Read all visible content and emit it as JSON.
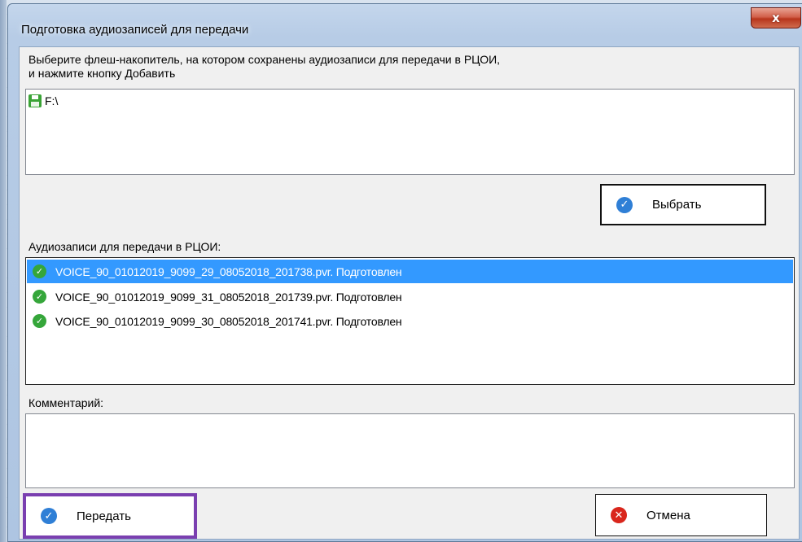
{
  "window": {
    "title": "Подготовка аудиозаписей для передачи",
    "close_symbol": "x"
  },
  "instructions": {
    "line1": "Выберите флеш-накопитель, на котором сохранены аудиозаписи для передачи в РЦОИ,",
    "line2": "и нажмите кнопку Добавить"
  },
  "drives": [
    {
      "label": "F:\\",
      "icon": "floppy-icon"
    }
  ],
  "select_button": {
    "label": "Выбрать",
    "icon": "check-circle-icon"
  },
  "recordings": {
    "label": "Аудиозаписи для передачи в РЦОИ:",
    "items": [
      {
        "name": "VOICE_90_01012019_9099_29_08052018_201738.pvr. Подготовлен",
        "selected": true
      },
      {
        "name": "VOICE_90_01012019_9099_31_08052018_201739.pvr. Подготовлен",
        "selected": false
      },
      {
        "name": "VOICE_90_01012019_9099_30_08052018_201741.pvr. Подготовлен",
        "selected": false
      }
    ],
    "status_icon": "green-check-icon"
  },
  "comment": {
    "label": "Комментарий:",
    "value": ""
  },
  "footer": {
    "send_label": "Передать",
    "cancel_label": "Отмена"
  },
  "colors": {
    "selection": "#3399ff",
    "send_highlight": "#7a3fb0",
    "check_blue": "#2f7fd6",
    "cancel_red": "#d9261c",
    "ok_green": "#35a63a"
  }
}
